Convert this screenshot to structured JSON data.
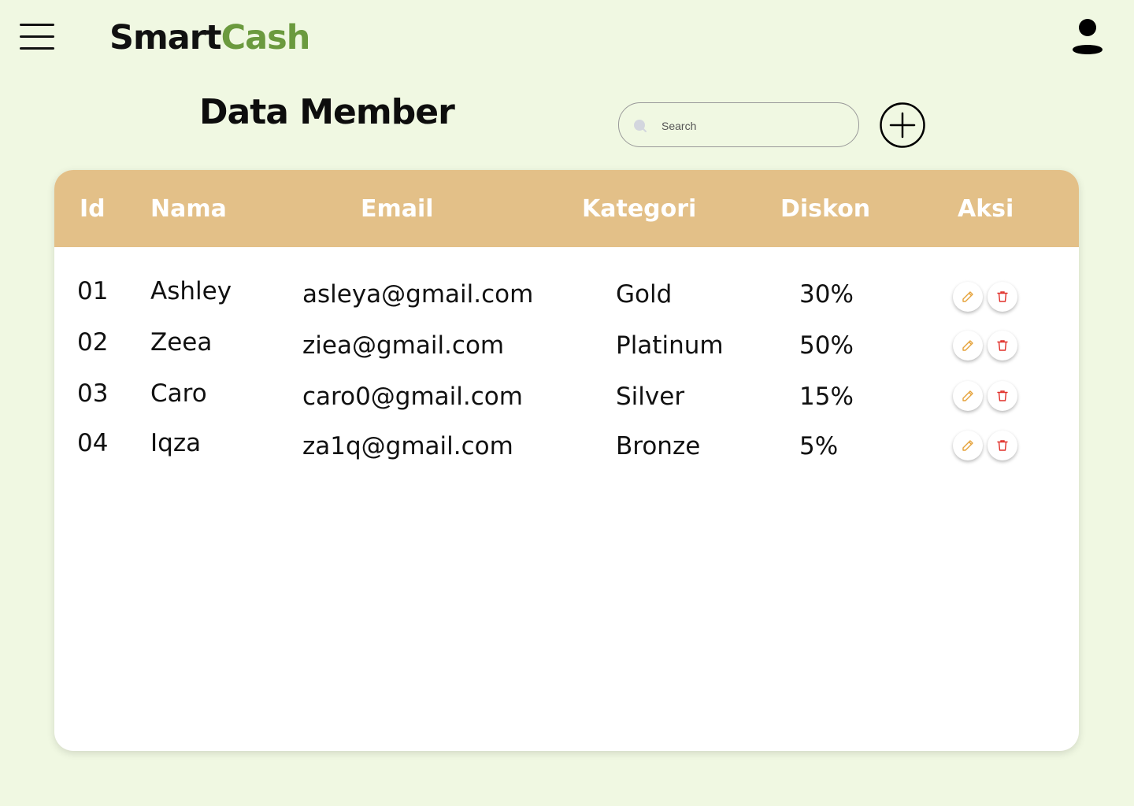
{
  "header": {
    "brand_part1": "Smart",
    "brand_part2": "Cash",
    "menu_icon": "hamburger-menu-icon",
    "user_icon": "user-profile-icon"
  },
  "page": {
    "title": "Data Member"
  },
  "search": {
    "placeholder": "Search",
    "value": ""
  },
  "actions": {
    "add_icon": "plus-circle-icon",
    "edit_icon": "pencil-icon",
    "delete_icon": "trash-icon"
  },
  "table": {
    "columns": [
      "Id",
      "Nama",
      "Email",
      "Kategori",
      "Diskon",
      "Aksi"
    ],
    "rows": [
      {
        "id": "01",
        "nama": "Ashley",
        "email": "asleya@gmail.com",
        "kategori": "Gold",
        "diskon": "30%"
      },
      {
        "id": "02",
        "nama": "Zeea",
        "email": "ziea@gmail.com",
        "kategori": "Platinum",
        "diskon": "50%"
      },
      {
        "id": "03",
        "nama": "Caro",
        "email": "caro0@gmail.com",
        "kategori": "Silver",
        "diskon": "15%"
      },
      {
        "id": "04",
        "nama": "Iqza",
        "email": "za1q@gmail.com",
        "kategori": "Bronze",
        "diskon": "5%"
      }
    ]
  },
  "colors": {
    "background": "#f0f8e2",
    "brand_accent": "#6b9a3e",
    "table_header": "#e3c088",
    "edit_icon": "#e5a23a",
    "delete_icon": "#e0302a"
  }
}
